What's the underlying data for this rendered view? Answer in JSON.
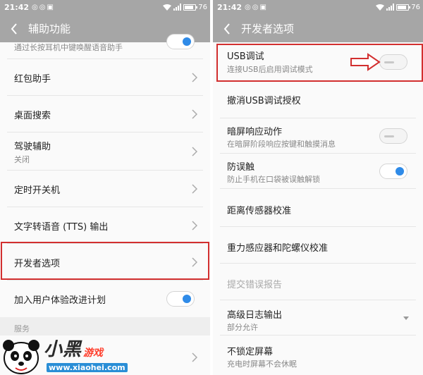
{
  "left": {
    "status": {
      "time": "21:42",
      "battery": "76"
    },
    "title": "辅助功能",
    "partial_item_sub": "通过长按耳机中键唤醒语音助手",
    "items": [
      {
        "label": "红包助手"
      },
      {
        "label": "桌面搜索"
      },
      {
        "label": "驾驶辅助",
        "sub": "关闭"
      },
      {
        "label": "定时开关机"
      },
      {
        "label": "文字转语音 (TTS) 输出"
      },
      {
        "label": "开发者选项"
      },
      {
        "label": "加入用户体验改进计划",
        "toggle": "on"
      }
    ],
    "section_header": "服务"
  },
  "right": {
    "status": {
      "time": "21:42",
      "battery": "76"
    },
    "title": "开发者选项",
    "items": [
      {
        "label": "USB调试",
        "sub": "连接USB后启用调试模式",
        "toggle": "off"
      },
      {
        "label": "撤消USB调试授权"
      },
      {
        "label": "暗屏响应动作",
        "sub": "在暗屏阶段响应按键和触摸消息",
        "toggle": "off"
      },
      {
        "label": "防误触",
        "sub": "防止手机在口袋被误触解锁",
        "toggle": "on"
      },
      {
        "label": "距离传感器校准"
      },
      {
        "label": "重力感应器和陀螺仪校准"
      },
      {
        "label": "提交错误报告",
        "disabled": true
      },
      {
        "label": "高级日志输出",
        "sub": "部分允许"
      },
      {
        "label": "不锁定屏幕",
        "sub": "充电时屏幕不会休眠"
      }
    ]
  },
  "watermark": {
    "brand": "小黑",
    "game": "游戏",
    "url": "www.xiaohei.com"
  },
  "colors": {
    "highlight": "#d22f2f",
    "toggle_on": "#2f8be8",
    "bar": "#a6a6a6"
  },
  "icons": [
    "back-arrow-icon",
    "chevron-right-icon",
    "dropdown-triangle-icon",
    "wifi-icon",
    "signal-icon",
    "battery-icon"
  ]
}
